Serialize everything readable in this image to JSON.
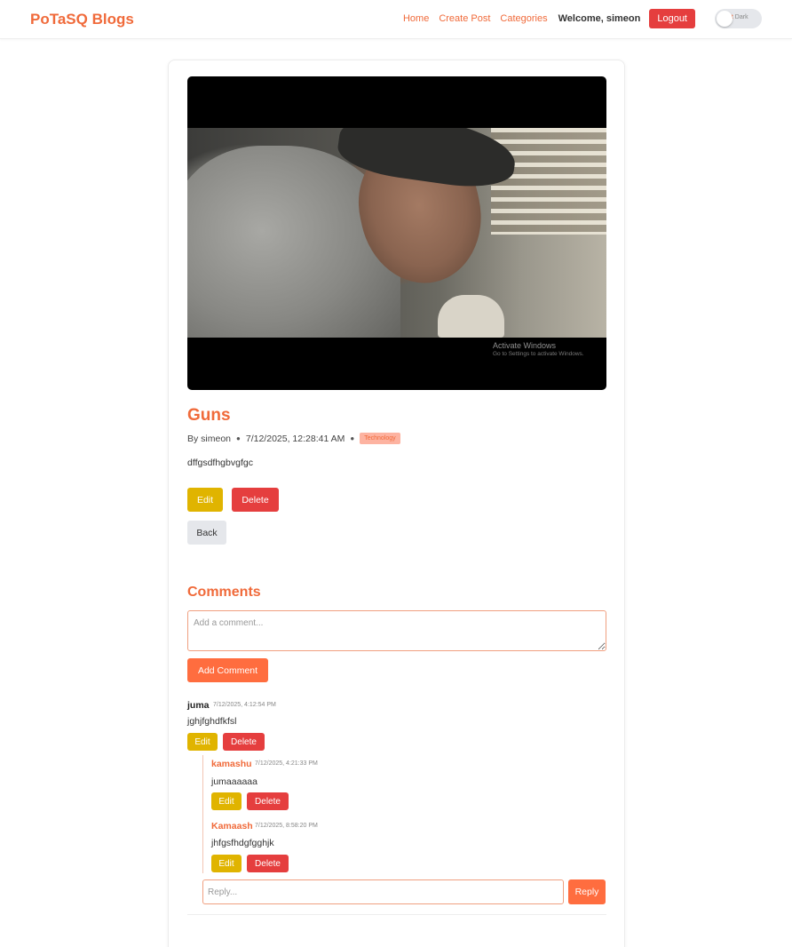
{
  "navbar": {
    "brand": "PoTaSQ Blogs",
    "links": [
      "Home",
      "Create Post",
      "Categories"
    ],
    "welcome": "Welcome, simeon",
    "logout_label": "Logout",
    "theme_toggle": {
      "light_label": "ht",
      "dark_label": "Dark"
    }
  },
  "image_watermark": {
    "title": "Activate Windows",
    "subtitle": "Go to Settings to activate Windows."
  },
  "post": {
    "title": "Guns",
    "author": "By simeon",
    "timestamp": "7/12/2025, 12:28:41 AM",
    "category": "Technology",
    "body": "dffgsdfhgbvgfgc",
    "edit_label": "Edit",
    "delete_label": "Delete",
    "back_label": "Back"
  },
  "comments": {
    "heading": "Comments",
    "input_placeholder": "Add a comment...",
    "add_label": "Add Comment",
    "items": [
      {
        "author": "juma",
        "time": "7/12/2025, 4:12:54 PM",
        "text": "jghjfghdfkfsl",
        "edit_label": "Edit",
        "delete_label": "Delete",
        "replies": [
          {
            "author": "kamashu",
            "time": "7/12/2025, 4:21:33 PM",
            "text": "jumaaaaaa",
            "edit_label": "Edit",
            "delete_label": "Delete"
          },
          {
            "author": "Kamaash",
            "time": "7/12/2025, 8:58:20 PM",
            "text": "jhfgsfhdgfgghjk",
            "edit_label": "Edit",
            "delete_label": "Delete"
          }
        ],
        "reply_placeholder": "Reply...",
        "reply_label": "Reply"
      }
    ]
  },
  "colors": {
    "accent": "#f06a3a",
    "danger": "#e53e3e",
    "warning": "#e0b400",
    "button_orange": "#ff6d3f"
  }
}
